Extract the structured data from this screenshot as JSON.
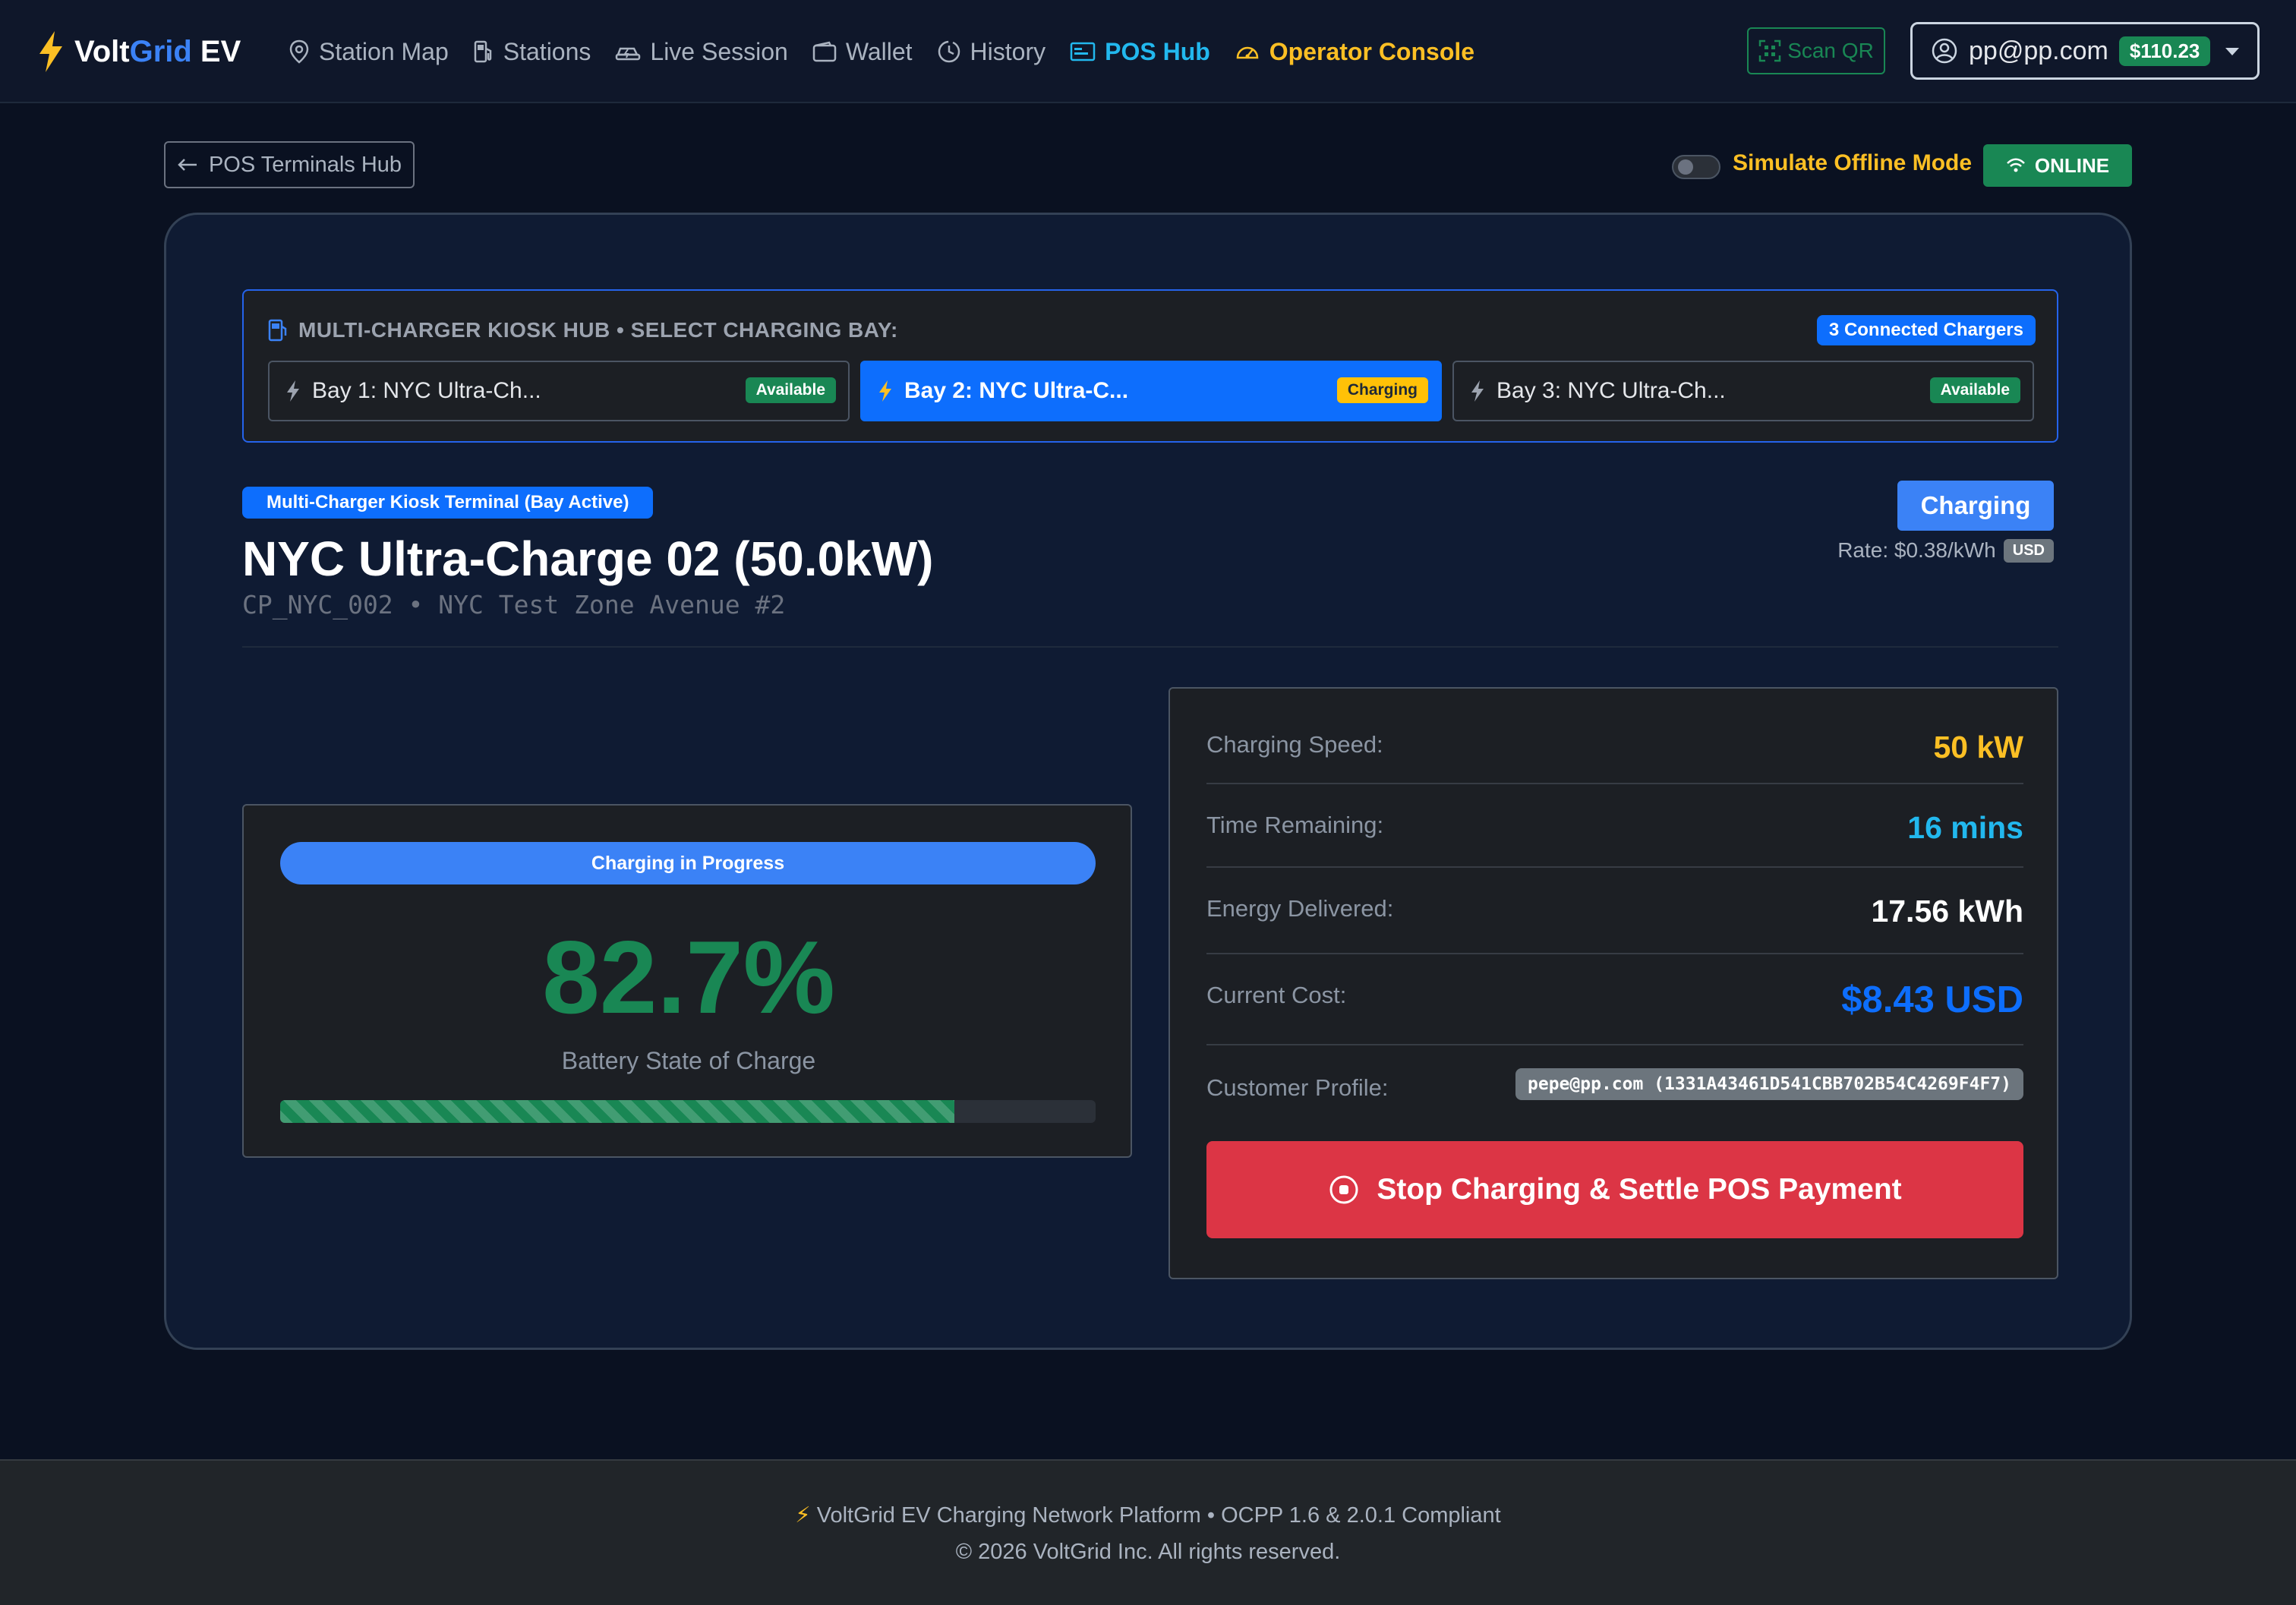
{
  "brand": {
    "name_part1": "Volt",
    "name_part2": "Grid",
    "name_part3": " EV",
    "icon": "bolt-icon"
  },
  "nav": {
    "items": [
      {
        "label": "Station Map",
        "icon": "map-pin-icon"
      },
      {
        "label": "Stations",
        "icon": "fuel-pump-icon"
      },
      {
        "label": "Live Session",
        "icon": "ev-car-icon"
      },
      {
        "label": "Wallet",
        "icon": "wallet-icon"
      },
      {
        "label": "History",
        "icon": "clock-history-icon"
      },
      {
        "label": "POS Hub",
        "icon": "pos-terminal-icon",
        "active": true
      },
      {
        "label": "Operator Console",
        "icon": "speedometer-icon"
      }
    ],
    "scan_qr": "Scan QR",
    "user_email": "pp@pp.com",
    "balance": "$110.23"
  },
  "toolbar": {
    "back_label": "POS Terminals Hub",
    "offline_label": "Simulate Offline Mode",
    "offline_enabled": false,
    "online_label": "ONLINE"
  },
  "kiosk": {
    "title": "MULTI-CHARGER KIOSK HUB • SELECT CHARGING BAY:",
    "connected": "3 Connected Chargers",
    "bays": [
      {
        "label": "Bay 1: NYC Ultra-Ch...",
        "status": "Available",
        "active": false
      },
      {
        "label": "Bay 2: NYC Ultra-C...",
        "status": "Charging",
        "active": true
      },
      {
        "label": "Bay 3: NYC Ultra-Ch...",
        "status": "Available",
        "active": false
      }
    ]
  },
  "station": {
    "terminal_badge": "Multi-Charger Kiosk Terminal (Bay Active)",
    "title": "NYC Ultra-Charge 02 (50.0kW)",
    "subtitle": "CP_NYC_002 • NYC Test Zone Avenue #2",
    "status": "Charging",
    "rate": "Rate: $0.38/kWh",
    "currency": "USD"
  },
  "battery": {
    "progress_label": "Charging in Progress",
    "soc_text": "82.7%",
    "soc_fraction": 0.827,
    "soc_caption": "Battery State of Charge"
  },
  "stats": {
    "speed_label": "Charging Speed:",
    "speed_value": "50 kW",
    "time_label": "Time Remaining:",
    "time_value": "16 mins",
    "energy_label": "Energy Delivered:",
    "energy_value": "17.56 kWh",
    "cost_label": "Current Cost:",
    "cost_value": "$8.43 USD",
    "profile_label": "Customer Profile:",
    "profile_value": "pepe@pp.com (1331A43461D541CBB702B54C4269F4F7)",
    "stop_label": "Stop Charging & Settle POS Payment"
  },
  "footer": {
    "line1": "VoltGrid EV Charging Network Platform • OCPP 1.6 & 2.0.1 Compliant",
    "line2": "© 2026 VoltGrid Inc. All rights reserved."
  },
  "colors": {
    "accent_blue": "#0d6efd",
    "success_green": "#198754",
    "warning_yellow": "#fbbf24",
    "danger_red": "#dc3545",
    "cyan": "#22b8ee"
  }
}
